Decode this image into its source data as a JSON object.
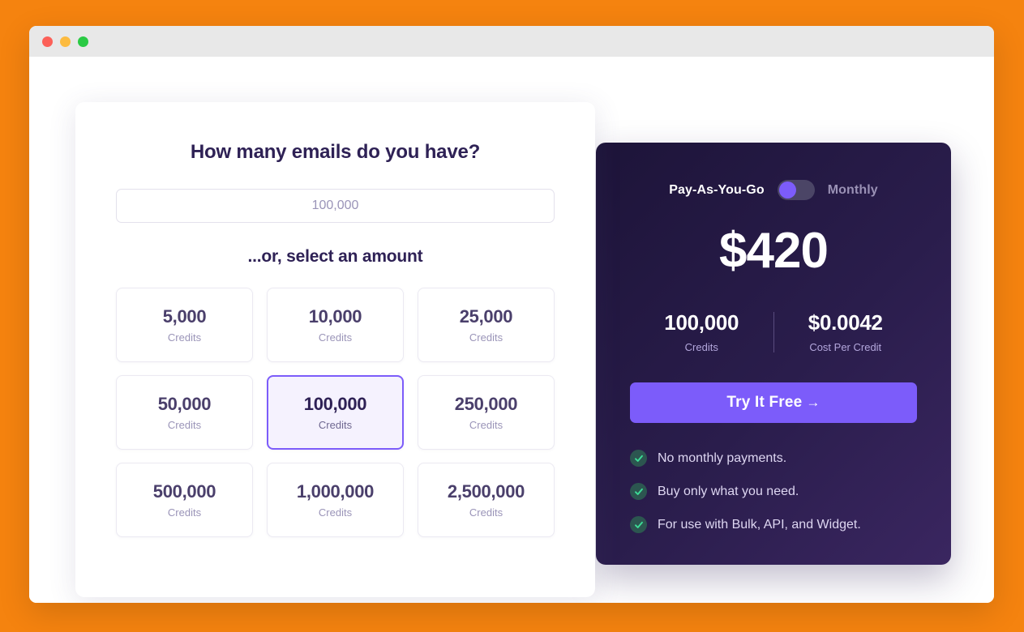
{
  "window": {
    "traffic_lights": [
      "close",
      "minimize",
      "maximize"
    ]
  },
  "selector": {
    "heading": "How many emails do you have?",
    "input_placeholder": "100,000",
    "input_value": "",
    "subheading": "...or, select an amount",
    "credit_label": "Credits",
    "options": [
      {
        "amount": "5,000",
        "label": "Credits",
        "selected": false
      },
      {
        "amount": "10,000",
        "label": "Credits",
        "selected": false
      },
      {
        "amount": "25,000",
        "label": "Credits",
        "selected": false
      },
      {
        "amount": "50,000",
        "label": "Credits",
        "selected": false
      },
      {
        "amount": "100,000",
        "label": "Credits",
        "selected": true
      },
      {
        "amount": "250,000",
        "label": "Credits",
        "selected": false
      },
      {
        "amount": "500,000",
        "label": "Credits",
        "selected": false
      },
      {
        "amount": "1,000,000",
        "label": "Credits",
        "selected": false
      },
      {
        "amount": "2,500,000",
        "label": "Credits",
        "selected": false
      }
    ]
  },
  "pricing": {
    "toggle": {
      "left_label": "Pay-As-You-Go",
      "right_label": "Monthly",
      "position": "left"
    },
    "price": "$420",
    "stats": [
      {
        "value": "100,000",
        "label": "Credits"
      },
      {
        "value": "$0.0042",
        "label": "Cost Per Credit"
      }
    ],
    "cta": {
      "label": "Try It Free",
      "arrow": "→"
    },
    "features": [
      "No monthly payments.",
      "Buy only what you need.",
      "For use with Bulk, API, and Widget."
    ]
  },
  "colors": {
    "page_background": "#f5830f",
    "accent_purple": "#7c5cfa",
    "panel_dark": "#1d1439",
    "check_green": "#3ddc97",
    "heading_text": "#2e2155"
  }
}
